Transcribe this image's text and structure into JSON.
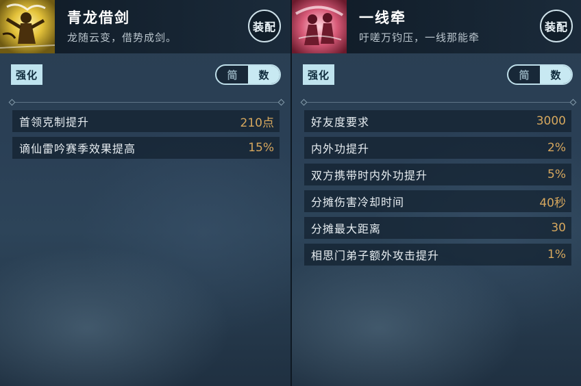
{
  "panels": [
    {
      "name": "青龙借剑",
      "description": "龙随云变，借势成剑。",
      "equip_label": "装配",
      "strengthen_label": "强化",
      "toggle": {
        "brief": "简",
        "numeric": "数",
        "active": "numeric"
      },
      "avatar_icon": "qinglong-sword-icon",
      "stats": [
        {
          "label": "首领克制提升",
          "value": "210点"
        },
        {
          "label": "谪仙雷吟赛季效果提高",
          "value": "15%"
        }
      ]
    },
    {
      "name": "一线牵",
      "description": "吁嗟万钧压，一线那能牵",
      "equip_label": "装配",
      "strengthen_label": "强化",
      "toggle": {
        "brief": "简",
        "numeric": "数",
        "active": "numeric"
      },
      "avatar_icon": "yixianqian-pair-icon",
      "stats": [
        {
          "label": "好友度要求",
          "value": "3000"
        },
        {
          "label": "内外功提升",
          "value": "2%"
        },
        {
          "label": "双方携带时内外功提升",
          "value": "5%"
        },
        {
          "label": "分摊伤害冷却时间",
          "value": "40秒"
        },
        {
          "label": "分摊最大距离",
          "value": "30"
        },
        {
          "label": "相思门弟子额外攻击提升",
          "value": "1%"
        }
      ]
    }
  ],
  "colors": {
    "value_text": "#d7a85e",
    "tab_bg": "#bfe3ee",
    "toggle_active_bg": "#c8e9f2"
  }
}
